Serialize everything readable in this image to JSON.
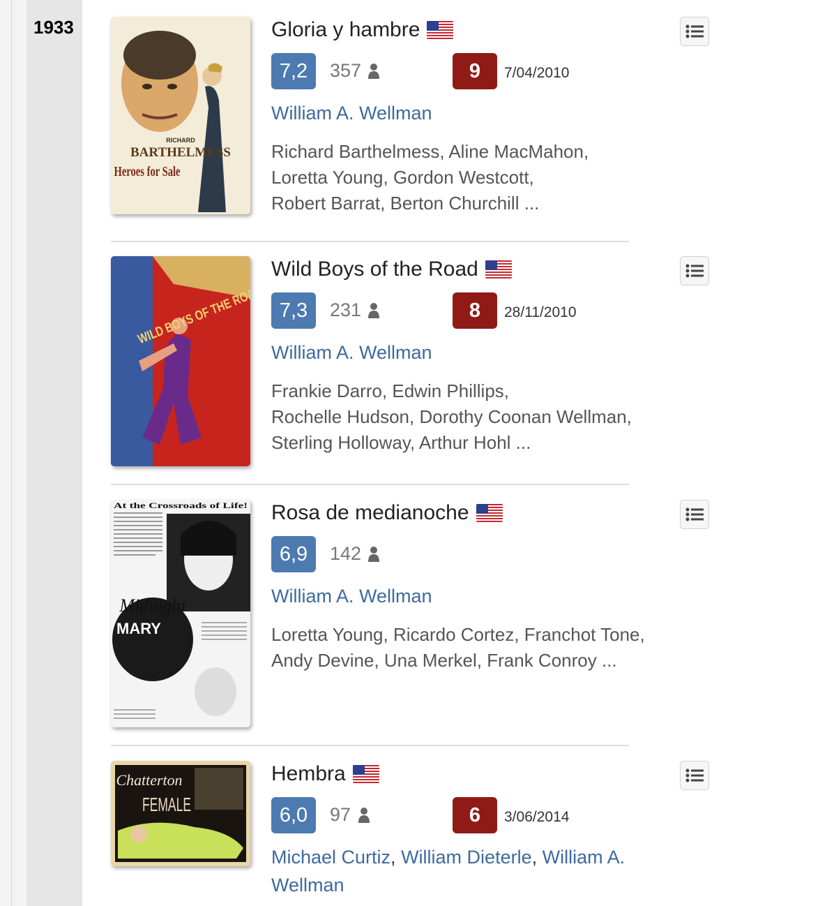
{
  "year": "1933",
  "icons": {
    "person": "person-icon",
    "list": "list-icon",
    "flag": "us-flag-icon"
  },
  "colors": {
    "average_badge": "#4d7ab1",
    "user_rating_badge": "#901a16",
    "link": "#3d6a9e"
  },
  "films": [
    {
      "title": "Gloria y hambre",
      "poster_title": "Heroes for Sale",
      "poster_text": [
        "RICHARD",
        "BARTHELMESS"
      ],
      "average": "7,2",
      "votes": "357",
      "my_rating": "9",
      "rating_date": "7/04/2010",
      "directors": [
        "William A. Wellman"
      ],
      "cast_lines": [
        "Richard Barthelmess, Aline MacMahon,",
        "Loretta Young, Gordon Westcott,",
        "Robert Barrat, Berton Churchill ..."
      ]
    },
    {
      "title": "Wild Boys of the Road",
      "poster_title": "WILD BOYS OF THE ROAD",
      "average": "7,3",
      "votes": "231",
      "my_rating": "8",
      "rating_date": "28/11/2010",
      "directors": [
        "William A. Wellman"
      ],
      "cast_lines": [
        "Frankie Darro, Edwin Phillips,",
        "Rochelle Hudson, Dorothy Coonan Wellman,",
        "Sterling Holloway, Arthur Hohl ..."
      ]
    },
    {
      "title": "Rosa de medianoche",
      "poster_title": "At the Crossroads of Life!",
      "poster_text": [
        "Midnight",
        "MARY"
      ],
      "average": "6,9",
      "votes": "142",
      "directors": [
        "William A. Wellman"
      ],
      "cast_lines": [
        "Loretta Young, Ricardo Cortez, Franchot Tone,",
        "Andy Devine, Una Merkel, Frank Conroy ..."
      ]
    },
    {
      "title": "Hembra",
      "poster_title": "Chatterton",
      "poster_text": [
        "FEMALE"
      ],
      "average": "6,0",
      "votes": "97",
      "my_rating": "6",
      "rating_date": "3/06/2014",
      "directors": [
        "Michael Curtiz",
        "William Dieterle",
        "William A.",
        "Wellman"
      ],
      "cast_lines": []
    }
  ]
}
